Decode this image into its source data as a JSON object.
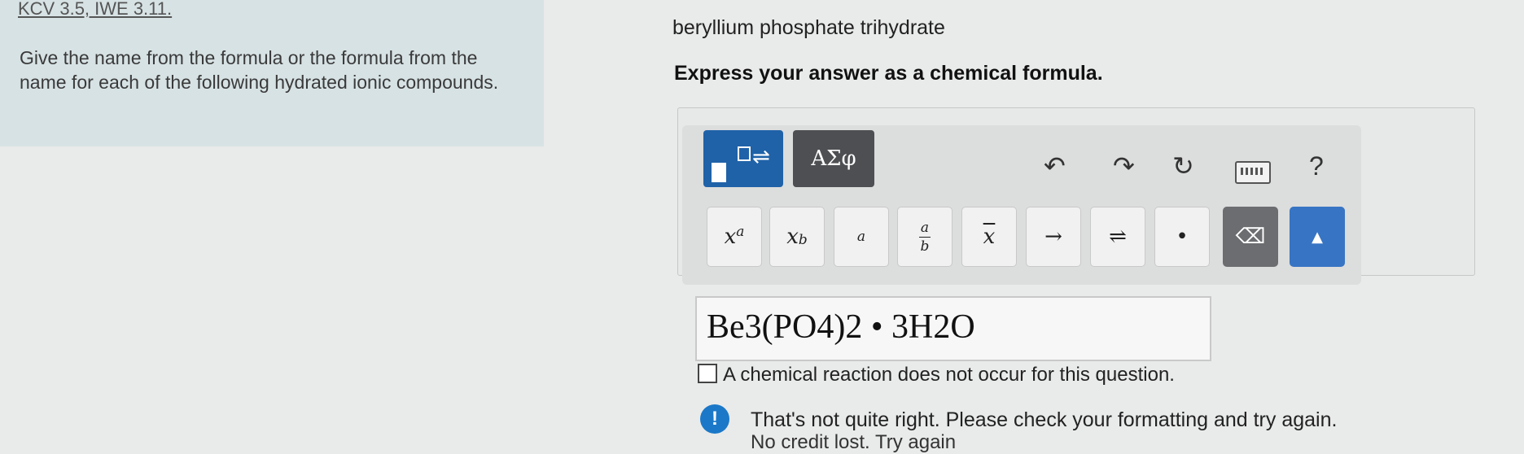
{
  "left_panel": {
    "reference": "KCV 3.5, IWE 3.11.",
    "prompt": "Give the name from the formula or the formula from the name for each of the following hydrated ionic compounds."
  },
  "question": {
    "compound": "beryllium phosphate trihydrate",
    "instruction": "Express your answer as a chemical formula."
  },
  "toolbar": {
    "greek_label": "ΑΣφ",
    "undo_icon": "undo-icon",
    "redo_icon": "redo-icon",
    "reset_icon": "reset-icon",
    "keyboard_icon": "keyboard-shortcuts-icon",
    "help_label": "?"
  },
  "keypad": {
    "superscript_base": "x",
    "superscript_exp": "a",
    "subscript_base": "x",
    "subscript_sub": "b",
    "charge_label": "a",
    "frac_num": "a",
    "frac_den": "b",
    "overline_label": "x",
    "arrow_label": "→",
    "equilibrium_label": "⇌",
    "dot_label": "•",
    "delete_label": "⌫",
    "keyboard_toggle": "▲"
  },
  "answer": {
    "value": "Be3(PO4)2 • 3H2O"
  },
  "no_reaction": {
    "label": "A chemical reaction does not occur for this question.",
    "checked": false
  },
  "feedback": {
    "message": "That's not quite right. Please check your formatting and try again.",
    "sub_message": "No credit lost. Try again",
    "icon_label": "!"
  },
  "colors": {
    "accent": "#1f62a8",
    "panel": "#d7e2e4",
    "warning": "#1b78c8"
  }
}
